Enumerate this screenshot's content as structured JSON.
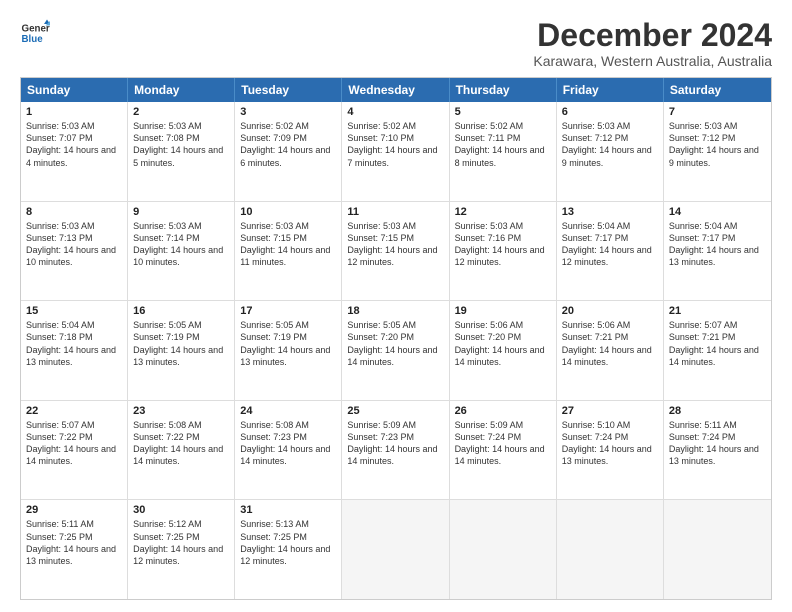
{
  "logo": {
    "line1": "General",
    "line2": "Blue"
  },
  "title": "December 2024",
  "subtitle": "Karawara, Western Australia, Australia",
  "header_days": [
    "Sunday",
    "Monday",
    "Tuesday",
    "Wednesday",
    "Thursday",
    "Friday",
    "Saturday"
  ],
  "weeks": [
    [
      {
        "day": "1",
        "sunrise": "5:03 AM",
        "sunset": "7:07 PM",
        "daylight": "14 hours and 4 minutes."
      },
      {
        "day": "2",
        "sunrise": "5:03 AM",
        "sunset": "7:08 PM",
        "daylight": "14 hours and 5 minutes."
      },
      {
        "day": "3",
        "sunrise": "5:02 AM",
        "sunset": "7:09 PM",
        "daylight": "14 hours and 6 minutes."
      },
      {
        "day": "4",
        "sunrise": "5:02 AM",
        "sunset": "7:10 PM",
        "daylight": "14 hours and 7 minutes."
      },
      {
        "day": "5",
        "sunrise": "5:02 AM",
        "sunset": "7:11 PM",
        "daylight": "14 hours and 8 minutes."
      },
      {
        "day": "6",
        "sunrise": "5:03 AM",
        "sunset": "7:12 PM",
        "daylight": "14 hours and 9 minutes."
      },
      {
        "day": "7",
        "sunrise": "5:03 AM",
        "sunset": "7:12 PM",
        "daylight": "14 hours and 9 minutes."
      }
    ],
    [
      {
        "day": "8",
        "sunrise": "5:03 AM",
        "sunset": "7:13 PM",
        "daylight": "14 hours and 10 minutes."
      },
      {
        "day": "9",
        "sunrise": "5:03 AM",
        "sunset": "7:14 PM",
        "daylight": "14 hours and 10 minutes."
      },
      {
        "day": "10",
        "sunrise": "5:03 AM",
        "sunset": "7:15 PM",
        "daylight": "14 hours and 11 minutes."
      },
      {
        "day": "11",
        "sunrise": "5:03 AM",
        "sunset": "7:15 PM",
        "daylight": "14 hours and 12 minutes."
      },
      {
        "day": "12",
        "sunrise": "5:03 AM",
        "sunset": "7:16 PM",
        "daylight": "14 hours and 12 minutes."
      },
      {
        "day": "13",
        "sunrise": "5:04 AM",
        "sunset": "7:17 PM",
        "daylight": "14 hours and 12 minutes."
      },
      {
        "day": "14",
        "sunrise": "5:04 AM",
        "sunset": "7:17 PM",
        "daylight": "14 hours and 13 minutes."
      }
    ],
    [
      {
        "day": "15",
        "sunrise": "5:04 AM",
        "sunset": "7:18 PM",
        "daylight": "14 hours and 13 minutes."
      },
      {
        "day": "16",
        "sunrise": "5:05 AM",
        "sunset": "7:19 PM",
        "daylight": "14 hours and 13 minutes."
      },
      {
        "day": "17",
        "sunrise": "5:05 AM",
        "sunset": "7:19 PM",
        "daylight": "14 hours and 13 minutes."
      },
      {
        "day": "18",
        "sunrise": "5:05 AM",
        "sunset": "7:20 PM",
        "daylight": "14 hours and 14 minutes."
      },
      {
        "day": "19",
        "sunrise": "5:06 AM",
        "sunset": "7:20 PM",
        "daylight": "14 hours and 14 minutes."
      },
      {
        "day": "20",
        "sunrise": "5:06 AM",
        "sunset": "7:21 PM",
        "daylight": "14 hours and 14 minutes."
      },
      {
        "day": "21",
        "sunrise": "5:07 AM",
        "sunset": "7:21 PM",
        "daylight": "14 hours and 14 minutes."
      }
    ],
    [
      {
        "day": "22",
        "sunrise": "5:07 AM",
        "sunset": "7:22 PM",
        "daylight": "14 hours and 14 minutes."
      },
      {
        "day": "23",
        "sunrise": "5:08 AM",
        "sunset": "7:22 PM",
        "daylight": "14 hours and 14 minutes."
      },
      {
        "day": "24",
        "sunrise": "5:08 AM",
        "sunset": "7:23 PM",
        "daylight": "14 hours and 14 minutes."
      },
      {
        "day": "25",
        "sunrise": "5:09 AM",
        "sunset": "7:23 PM",
        "daylight": "14 hours and 14 minutes."
      },
      {
        "day": "26",
        "sunrise": "5:09 AM",
        "sunset": "7:24 PM",
        "daylight": "14 hours and 14 minutes."
      },
      {
        "day": "27",
        "sunrise": "5:10 AM",
        "sunset": "7:24 PM",
        "daylight": "14 hours and 13 minutes."
      },
      {
        "day": "28",
        "sunrise": "5:11 AM",
        "sunset": "7:24 PM",
        "daylight": "14 hours and 13 minutes."
      }
    ],
    [
      {
        "day": "29",
        "sunrise": "5:11 AM",
        "sunset": "7:25 PM",
        "daylight": "14 hours and 13 minutes."
      },
      {
        "day": "30",
        "sunrise": "5:12 AM",
        "sunset": "7:25 PM",
        "daylight": "14 hours and 12 minutes."
      },
      {
        "day": "31",
        "sunrise": "5:13 AM",
        "sunset": "7:25 PM",
        "daylight": "14 hours and 12 minutes."
      },
      null,
      null,
      null,
      null
    ]
  ],
  "labels": {
    "sunrise": "Sunrise:",
    "sunset": "Sunset:",
    "daylight": "Daylight:"
  }
}
